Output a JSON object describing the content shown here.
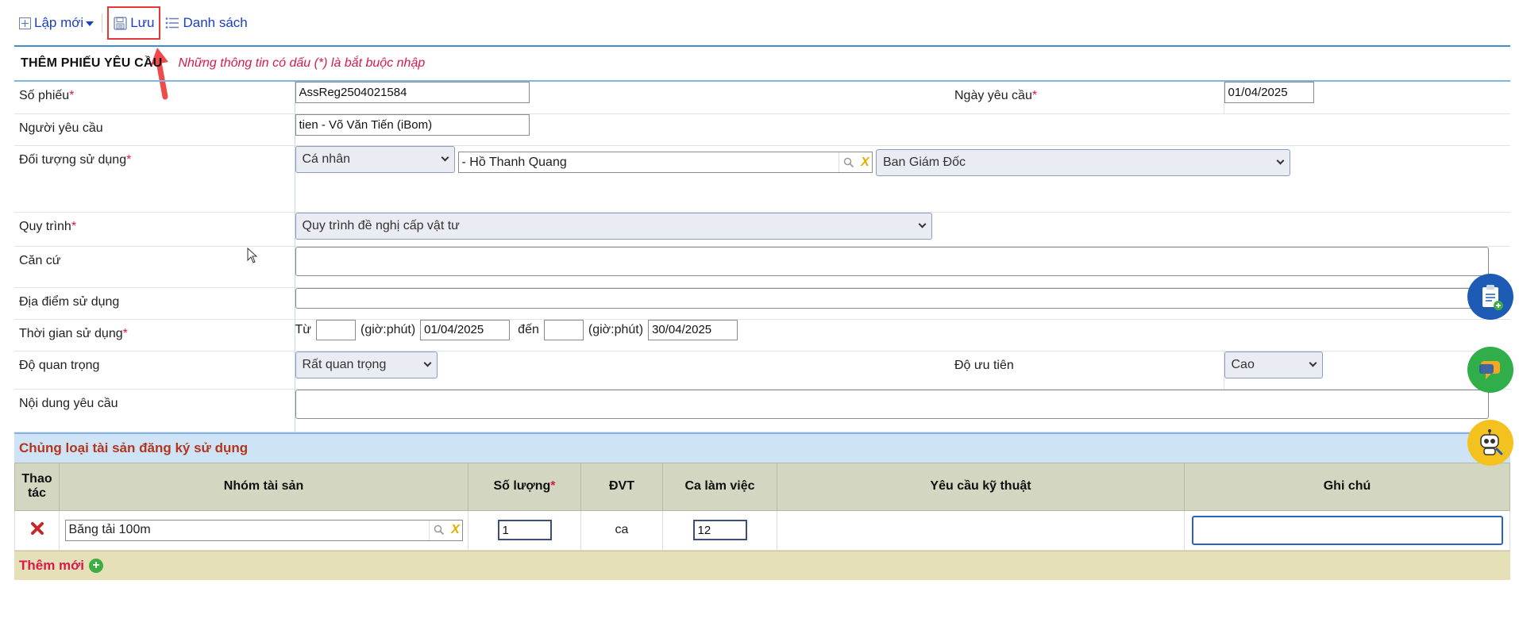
{
  "toolbar": {
    "new_label": "Lập mới",
    "save_label": "Lưu",
    "list_label": "Danh sách"
  },
  "header": {
    "title": "THÊM PHIẾU YÊU CẦU",
    "note": "Những thông tin có dấu (*) là bắt buộc nhập"
  },
  "form": {
    "so_phieu": {
      "label": "Số phiếu",
      "value": "AssReg2504021584"
    },
    "ngay_yeu_cau": {
      "label": "Ngày yêu cầu",
      "value": "01/04/2025"
    },
    "nguoi_yeu_cau": {
      "label": "Người yêu cầu",
      "value": "tien - Võ Văn Tiến (iBom)"
    },
    "doi_tuong": {
      "label": "Đối tượng sử dụng",
      "type_value": "Cá nhân",
      "person_value": "- Hồ Thanh Quang",
      "department_value": "Ban Giám Đốc"
    },
    "quy_trinh": {
      "label": "Quy trình",
      "value": "Quy trình đề nghị cấp vật tư"
    },
    "can_cu": {
      "label": "Căn cứ",
      "value": ""
    },
    "dia_diem": {
      "label": "Địa điểm sử dụng",
      "value": ""
    },
    "thoi_gian": {
      "label": "Thời gian sử dụng",
      "from_label": "Từ",
      "time_hint": "(giờ:phút)",
      "from_date": "01/04/2025",
      "to_label": "đến",
      "to_date": "30/04/2025"
    },
    "do_quan_trong": {
      "label": "Độ quan trọng",
      "value": "Rất quan trọng"
    },
    "do_uu_tien": {
      "label": "Độ ưu tiên",
      "value": "Cao"
    },
    "noi_dung": {
      "label": "Nội dung yêu cầu",
      "value": ""
    }
  },
  "assets": {
    "title": "Chủng loại tài sản đăng ký sử dụng",
    "columns": [
      "Thao tác",
      "Nhóm tài sản",
      "Số lượng",
      "ĐVT",
      "Ca làm việc",
      "Yêu cầu kỹ thuật",
      "Ghi chú"
    ],
    "rows": [
      {
        "group": "Băng tải 100m",
        "qty": "1",
        "unit": "ca",
        "shift": "12",
        "tech": "",
        "note": ""
      }
    ],
    "add_label": "Thêm mới"
  },
  "colors": {
    "accent": "#1a3fc4",
    "required": "#d8194a",
    "section_title": "#b2361c"
  },
  "icons": [
    "plus-square-icon",
    "save-icon",
    "list-icon",
    "search-icon",
    "clear-x-icon",
    "delete-icon",
    "add-circle-icon",
    "clipboard-add-icon",
    "chat-icon",
    "robot-icon"
  ]
}
